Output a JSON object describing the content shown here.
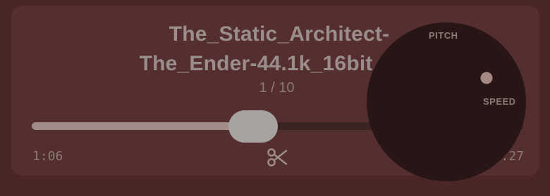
{
  "player": {
    "title_line1": "The_Static_Architect-",
    "title_line2": "The_Ender-44.1k_16bit.wav",
    "track_counter": "1 / 10",
    "elapsed_time": "1:06",
    "total_time": "2:27",
    "progress_fraction": 0.45,
    "trim_icon": "scissors-icon"
  },
  "knob": {
    "pitch_label": "PITCH",
    "speed_label": "SPEED",
    "speed_fraction": 0.75,
    "pitch_fraction": 0.35
  },
  "colors": {
    "background": "#4a2626",
    "panel": "#552f2f",
    "knob": "#281515",
    "accent": "#a48a83"
  }
}
